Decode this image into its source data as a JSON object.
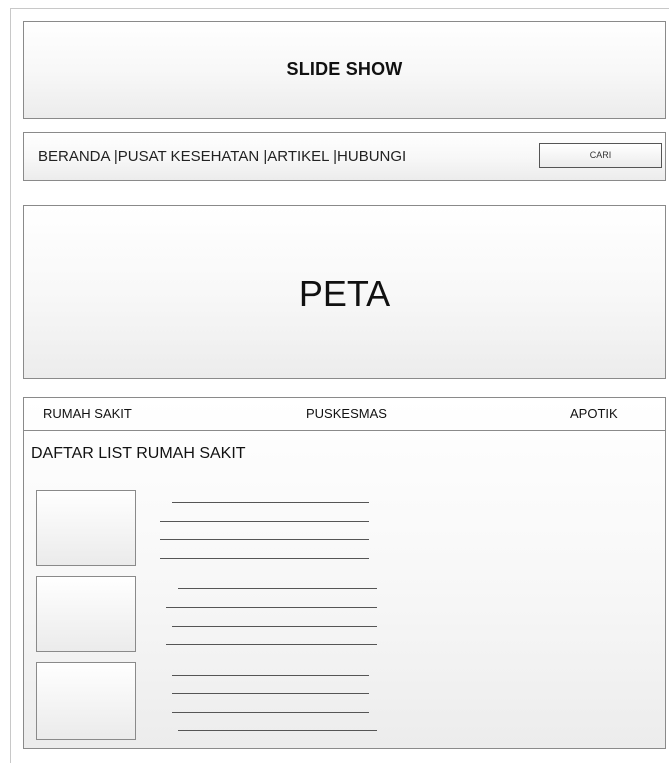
{
  "header": {
    "slideshow_label": "SLIDE SHOW"
  },
  "nav": {
    "items": [
      {
        "label": "BERANDA |"
      },
      {
        "label": "PUSAT KESEHATAN |"
      },
      {
        "label": "ARTIKEL |"
      },
      {
        "label": "HUBUNGI"
      }
    ],
    "search_label": "CARI"
  },
  "map": {
    "label": "PETA"
  },
  "tabs": [
    {
      "label": "RUMAH SAKIT"
    },
    {
      "label": "PUSKESMAS"
    },
    {
      "label": "APOTIK"
    }
  ],
  "list": {
    "title": "DAFTAR LIST RUMAH SAKIT"
  }
}
